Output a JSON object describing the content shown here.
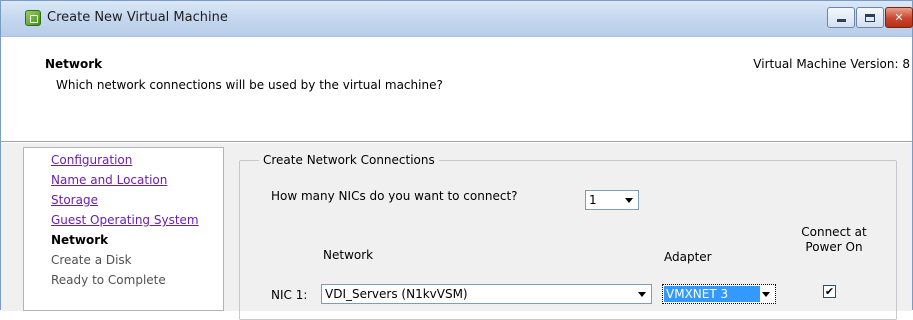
{
  "window": {
    "title": "Create New Virtual Machine",
    "close_glyph": "✕"
  },
  "header": {
    "title": "Network",
    "subtitle": "Which network connections will be used by the virtual machine?",
    "version": "Virtual Machine Version: 8"
  },
  "nav": {
    "items": [
      {
        "label": "Configuration",
        "state": "link"
      },
      {
        "label": "Name and Location",
        "state": "link"
      },
      {
        "label": "Storage",
        "state": "link"
      },
      {
        "label": "Guest Operating System",
        "state": "link"
      },
      {
        "label": "Network",
        "state": "current"
      },
      {
        "label": "Create a Disk",
        "state": "pending"
      },
      {
        "label": "Ready to Complete",
        "state": "pending"
      }
    ]
  },
  "content": {
    "group_title": "Create Network Connections",
    "question": "How many NICs do you want to connect?",
    "nic_count": "1",
    "columns": {
      "network": "Network",
      "adapter": "Adapter",
      "connect_line1": "Connect at",
      "connect_line2": "Power On"
    },
    "nics": [
      {
        "label": "NIC 1:",
        "network": "VDI_Servers (N1kvVSM)",
        "adapter": "VMXNET 3",
        "connect_at_power_on": true,
        "check_glyph": "✔"
      }
    ]
  },
  "colors": {
    "link": "#6a1fb0",
    "selection": "#3399ff",
    "close_button": "#c9452a"
  }
}
